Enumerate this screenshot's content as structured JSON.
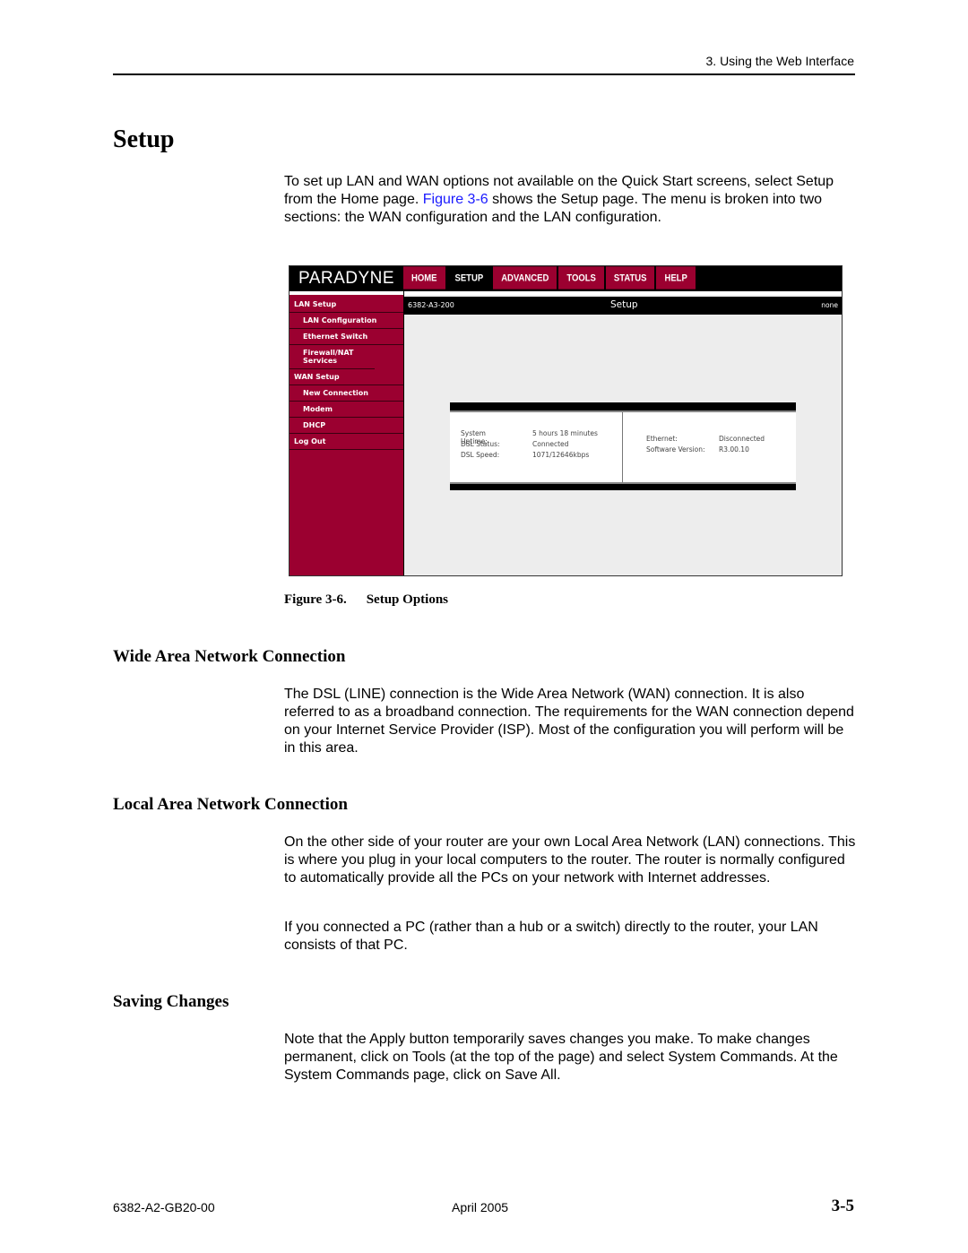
{
  "header": {
    "chapter": "3. Using the Web Interface"
  },
  "page_title": "Setup",
  "intro": {
    "text_before": "To set up LAN and WAN options not available on the Quick Start screens, select Setup from the Home page. ",
    "figure_link": "Figure 3-6",
    "text_after": " shows the Setup page. The menu is broken into two sections: the WAN configuration and the LAN configuration."
  },
  "figure": {
    "router_ui": {
      "logo": "PARADYNE",
      "nav_tabs": [
        {
          "label": "HOME",
          "active": false
        },
        {
          "label": "SETUP",
          "active": true
        },
        {
          "label": "ADVANCED",
          "active": false
        },
        {
          "label": "TOOLS",
          "active": false
        },
        {
          "label": "STATUS",
          "active": false
        },
        {
          "label": "HELP",
          "active": false
        }
      ],
      "model": "6382-A3-200",
      "page_heading": "Setup",
      "user_status": "none",
      "sidebar": [
        {
          "label": "LAN Setup",
          "type": "section"
        },
        {
          "label": "LAN Configuration",
          "type": "sub"
        },
        {
          "label": "Ethernet Switch",
          "type": "sub"
        },
        {
          "label": "Firewall/NAT Services",
          "type": "sub"
        },
        {
          "label": "WAN Setup",
          "type": "section"
        },
        {
          "label": "New Connection",
          "type": "sub"
        },
        {
          "label": "Modem",
          "type": "sub"
        },
        {
          "label": "DHCP",
          "type": "sub"
        },
        {
          "label": "Log Out",
          "type": "section"
        }
      ],
      "status_left": [
        {
          "label": "System Uptime:",
          "value": "5 hours 18 minutes"
        },
        {
          "label": "DSL Status:",
          "value": "Connected"
        },
        {
          "label": "DSL Speed:",
          "value": "1071/12646kbps"
        }
      ],
      "status_right": [
        {
          "label": "Ethernet:",
          "value": "Disconnected"
        },
        {
          "label": "Software Version:",
          "value": "R3.00.10"
        }
      ],
      "colors": {
        "brand_red": "#9b0030",
        "bar_black": "#000000",
        "content_bg": "#ededed"
      }
    },
    "caption_number": "Figure 3-6.",
    "caption_title": "Setup Options"
  },
  "sections": [
    {
      "heading": "Wide Area Network Connection",
      "paragraphs": [
        "The DSL (LINE) connection is the Wide Area Network (WAN) connection. It is also referred to as a broadband connection. The requirements for the WAN connection depend on your Internet Service Provider (ISP). Most of the configuration you will perform will be in this area."
      ]
    },
    {
      "heading": "Local Area Network Connection",
      "paragraphs": [
        "On the other side of your router are your own Local Area Network (LAN) connections. This is where you plug in your local computers to the router. The router is normally configured to automatically provide all the PCs on your network with Internet addresses.",
        "If you connected a PC (rather than a hub or a switch) directly to the router, your LAN consists of that PC."
      ]
    },
    {
      "heading": "Saving Changes",
      "paragraphs": [
        "Note that the Apply button temporarily saves changes you make. To make changes permanent, click on Tools (at the top of the page) and select System Commands. At the System Commands page, click on Save All."
      ]
    }
  ],
  "footer": {
    "doc_number": "6382-A2-GB20-00",
    "date": "April 2005",
    "page_number": "3-5"
  }
}
